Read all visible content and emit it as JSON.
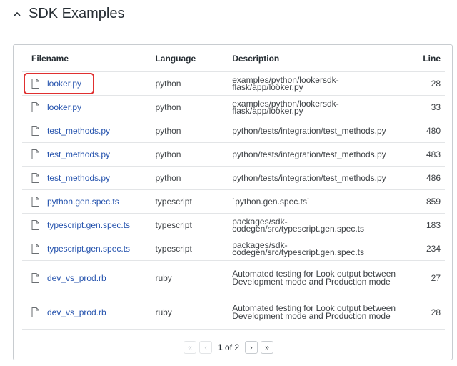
{
  "section": {
    "title": "SDK Examples",
    "icon": "chevron-up-icon"
  },
  "table": {
    "headers": {
      "filename": "Filename",
      "language": "Language",
      "description": "Description",
      "line": "Line"
    },
    "rows": [
      {
        "filename": "looker.py",
        "language": "python",
        "description": "examples/python/lookersdk-flask/app/looker.py",
        "line": "28"
      },
      {
        "filename": "looker.py",
        "language": "python",
        "description": "examples/python/lookersdk-flask/app/looker.py",
        "line": "33"
      },
      {
        "filename": "test_methods.py",
        "language": "python",
        "description": "python/tests/integration/test_methods.py",
        "line": "480"
      },
      {
        "filename": "test_methods.py",
        "language": "python",
        "description": "python/tests/integration/test_methods.py",
        "line": "483"
      },
      {
        "filename": "test_methods.py",
        "language": "python",
        "description": "python/tests/integration/test_methods.py",
        "line": "486"
      },
      {
        "filename": "python.gen.spec.ts",
        "language": "typescript",
        "description": "`python.gen.spec.ts`",
        "line": "859"
      },
      {
        "filename": "typescript.gen.spec.ts",
        "language": "typescript",
        "description": "packages/sdk-codegen/src/typescript.gen.spec.ts",
        "line": "183"
      },
      {
        "filename": "typescript.gen.spec.ts",
        "language": "typescript",
        "description": "packages/sdk-codegen/src/typescript.gen.spec.ts",
        "line": "234"
      },
      {
        "filename": "dev_vs_prod.rb",
        "language": "ruby",
        "description": "Automated testing for Look output between Development mode and Production mode",
        "line": "27"
      },
      {
        "filename": "dev_vs_prod.rb",
        "language": "ruby",
        "description": "Automated testing for Look output between Development mode and Production mode",
        "line": "28"
      }
    ]
  },
  "pagination": {
    "current": "1",
    "of_label": "of 2",
    "first": "«",
    "prev": "‹",
    "next": "›",
    "last": "»"
  },
  "colors": {
    "link": "#2452ad",
    "highlight": "#e03030",
    "border": "#c8ccd0"
  }
}
